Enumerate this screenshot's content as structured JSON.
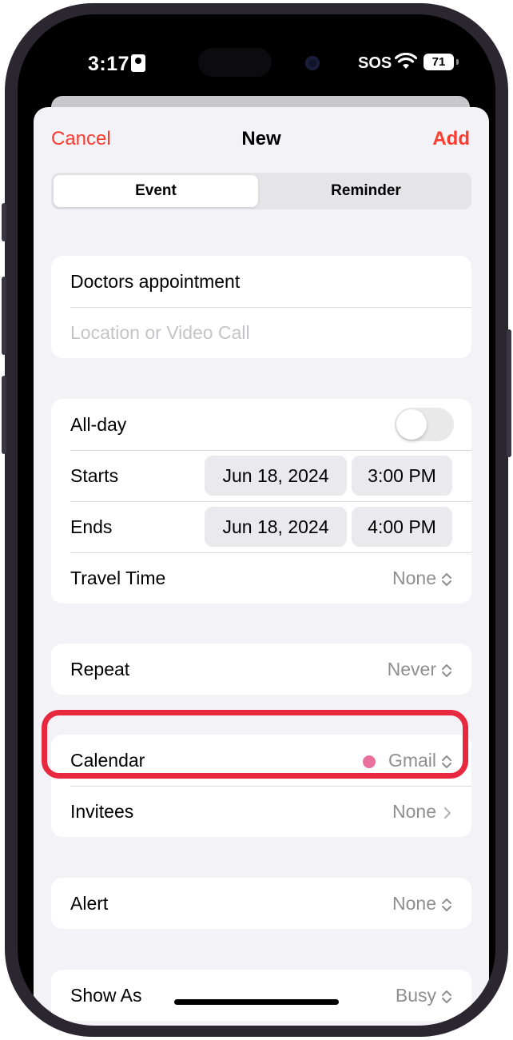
{
  "status_bar": {
    "time": "3:17",
    "sos": "SOS",
    "battery": "71"
  },
  "nav": {
    "cancel": "Cancel",
    "title": "New",
    "add": "Add"
  },
  "segments": {
    "event": "Event",
    "reminder": "Reminder",
    "selected": "Event"
  },
  "details": {
    "title_value": "Doctors appointment",
    "location_placeholder": "Location or Video Call"
  },
  "timing": {
    "allday_label": "All-day",
    "allday_on": false,
    "starts_label": "Starts",
    "starts_date": "Jun 18, 2024",
    "starts_time": "3:00 PM",
    "ends_label": "Ends",
    "ends_date": "Jun 18, 2024",
    "ends_time": "4:00 PM",
    "travel_label": "Travel Time",
    "travel_value": "None"
  },
  "repeat": {
    "label": "Repeat",
    "value": "Never"
  },
  "calendar": {
    "label": "Calendar",
    "value": "Gmail",
    "color": "#e8709a",
    "invitees_label": "Invitees",
    "invitees_value": "None"
  },
  "alert": {
    "label": "Alert",
    "value": "None"
  },
  "show_as": {
    "label": "Show As",
    "value": "Busy"
  },
  "colors": {
    "accent": "#ff3b30",
    "highlight": "#e8283f"
  }
}
